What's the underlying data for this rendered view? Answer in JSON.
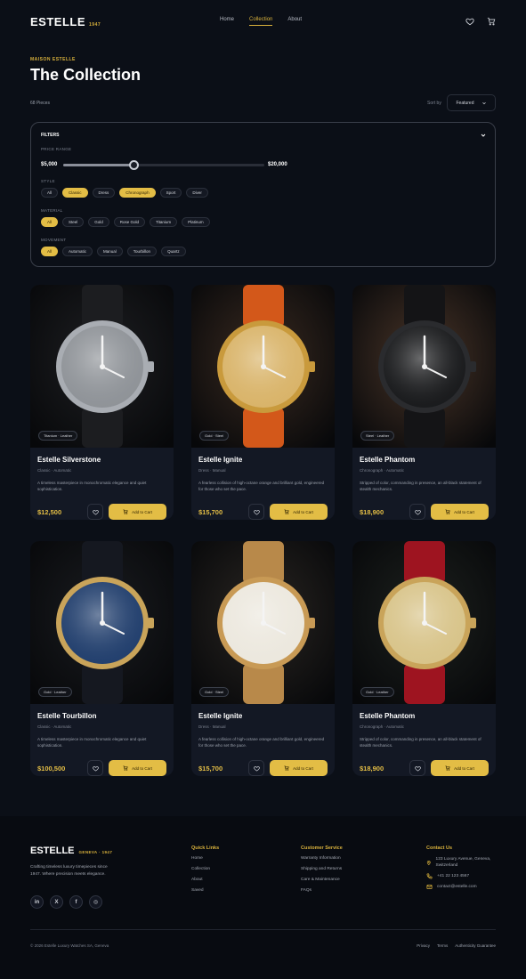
{
  "nav": {
    "brand": "ESTELLE",
    "brand_year": "1947",
    "links": [
      "Home",
      "Collection",
      "About"
    ],
    "active": "Collection",
    "icons": [
      "heart-icon",
      "cart-icon"
    ]
  },
  "header": {
    "eyebrow": "MAISON ESTELLE",
    "title": "The Collection",
    "count": "68 Pieces",
    "sort_label": "Sort by",
    "sort_value": "Featured"
  },
  "filters": {
    "title": "FILTERS",
    "price_label": "PRICE RANGE",
    "price_min": "$5,000",
    "price_max": "$20,000",
    "slider_fraction": 0.35,
    "style_label": "STYLE",
    "style": [
      "All",
      "Classic",
      "Dress",
      "Chronograph",
      "Sport",
      "Diver"
    ],
    "style_selected": [
      "Classic",
      "Chronograph"
    ],
    "material_label": "MATERIAL",
    "material": [
      "All",
      "Steel",
      "Gold",
      "Rose Gold",
      "Titanium",
      "Platinum"
    ],
    "material_selected": [
      "All"
    ],
    "movement_label": "MOVEMENT",
    "movement": [
      "All",
      "Automatic",
      "Manual",
      "Tourbillon",
      "Quartz"
    ],
    "movement_selected": [
      "All"
    ]
  },
  "products": [
    {
      "name": "Estelle Silverstone",
      "category": "Classic · Automatic",
      "desc": "A timeless masterpiece in monochromatic elegance and quiet sophistication.",
      "price": "$12,500",
      "tag": "Titanium · Leather",
      "add": "Add to Cart",
      "case": "#a9adb3",
      "dial": "#8f9398",
      "strap": "#1c1d20",
      "bg": "#1e1f22"
    },
    {
      "name": "Estelle Ignite",
      "category": "Dress · Manual",
      "desc": "A fearless collision of high-octane orange and brilliant gold, engineered for those who set the pace.",
      "price": "$15,700",
      "tag": "Gold · Steel",
      "add": "Add to Cart",
      "case": "#c99a3c",
      "dial": "#d9b46a",
      "strap": "#d3581a",
      "bg": "#3a2a20"
    },
    {
      "name": "Estelle Phantom",
      "category": "Chronograph · Automatic",
      "desc": "Stripped of color, commanding in presence, an all-black statement of stealth mechanics.",
      "price": "$18,900",
      "tag": "Steel · Leather",
      "add": "Add to Cart",
      "case": "#2a2b2e",
      "dial": "#1a1b1d",
      "strap": "#141416",
      "bg": "#4a3528"
    },
    {
      "name": "Estelle Tourbillon",
      "category": "Classic · Automatic",
      "desc": "A timeless masterpiece in monochromatic elegance and quiet sophistication.",
      "price": "$100,500",
      "tag": "Gold · Leather",
      "add": "Add to Cart",
      "case": "#c9a45a",
      "dial": "#23406e",
      "strap": "#151820",
      "bg": "#1a1c20"
    },
    {
      "name": "Estelle Ignite",
      "category": "Dress · Manual",
      "desc": "A fearless collision of high-octane orange and brilliant gold, engineered for those who set the pace.",
      "price": "$15,700",
      "tag": "Gold · Steel",
      "add": "Add to Cart",
      "case": "#c89a55",
      "dial": "#ece8de",
      "strap": "#b8894a",
      "bg": "#2a2622"
    },
    {
      "name": "Estelle Phantom",
      "category": "Chronograph · Automatic",
      "desc": "Stripped of color, commanding in presence, an all-black statement of stealth mechanics.",
      "price": "$18,900",
      "tag": "Gold · Leather",
      "add": "Add to Cart",
      "case": "#c9a45a",
      "dial": "#d8c48a",
      "strap": "#9e1420",
      "bg": "#1d211e"
    }
  ],
  "footer": {
    "brand": "ESTELLE",
    "brand_location": "GENEVA · 1947",
    "tagline": "Crafting timeless luxury timepieces since 1947. Where precision meets elegance.",
    "socials": [
      "in",
      "X",
      "f",
      "◎"
    ],
    "quick_links_title": "Quick Links",
    "quick_links": [
      "Home",
      "Collection",
      "About",
      "Saved"
    ],
    "service_title": "Customer Service",
    "service_links": [
      "Warranty Information",
      "Shipping and Returns",
      "Care & Maintenance",
      "FAQs"
    ],
    "contact_title": "Contact Us",
    "contact_address": "123 Luxury Avenue, Geneva, Switzerland",
    "contact_phone": "+41 22 123 4567",
    "contact_email": "contact@estelle.com",
    "copyright": "© 2026 Estelle Luxury Watches SA, Geneva",
    "legal": [
      "Privacy",
      "Terms",
      "Authenticity Guarantee"
    ]
  },
  "colors": {
    "accent": "#e3bd45",
    "background": "#0b0f17",
    "card": "#131824"
  }
}
